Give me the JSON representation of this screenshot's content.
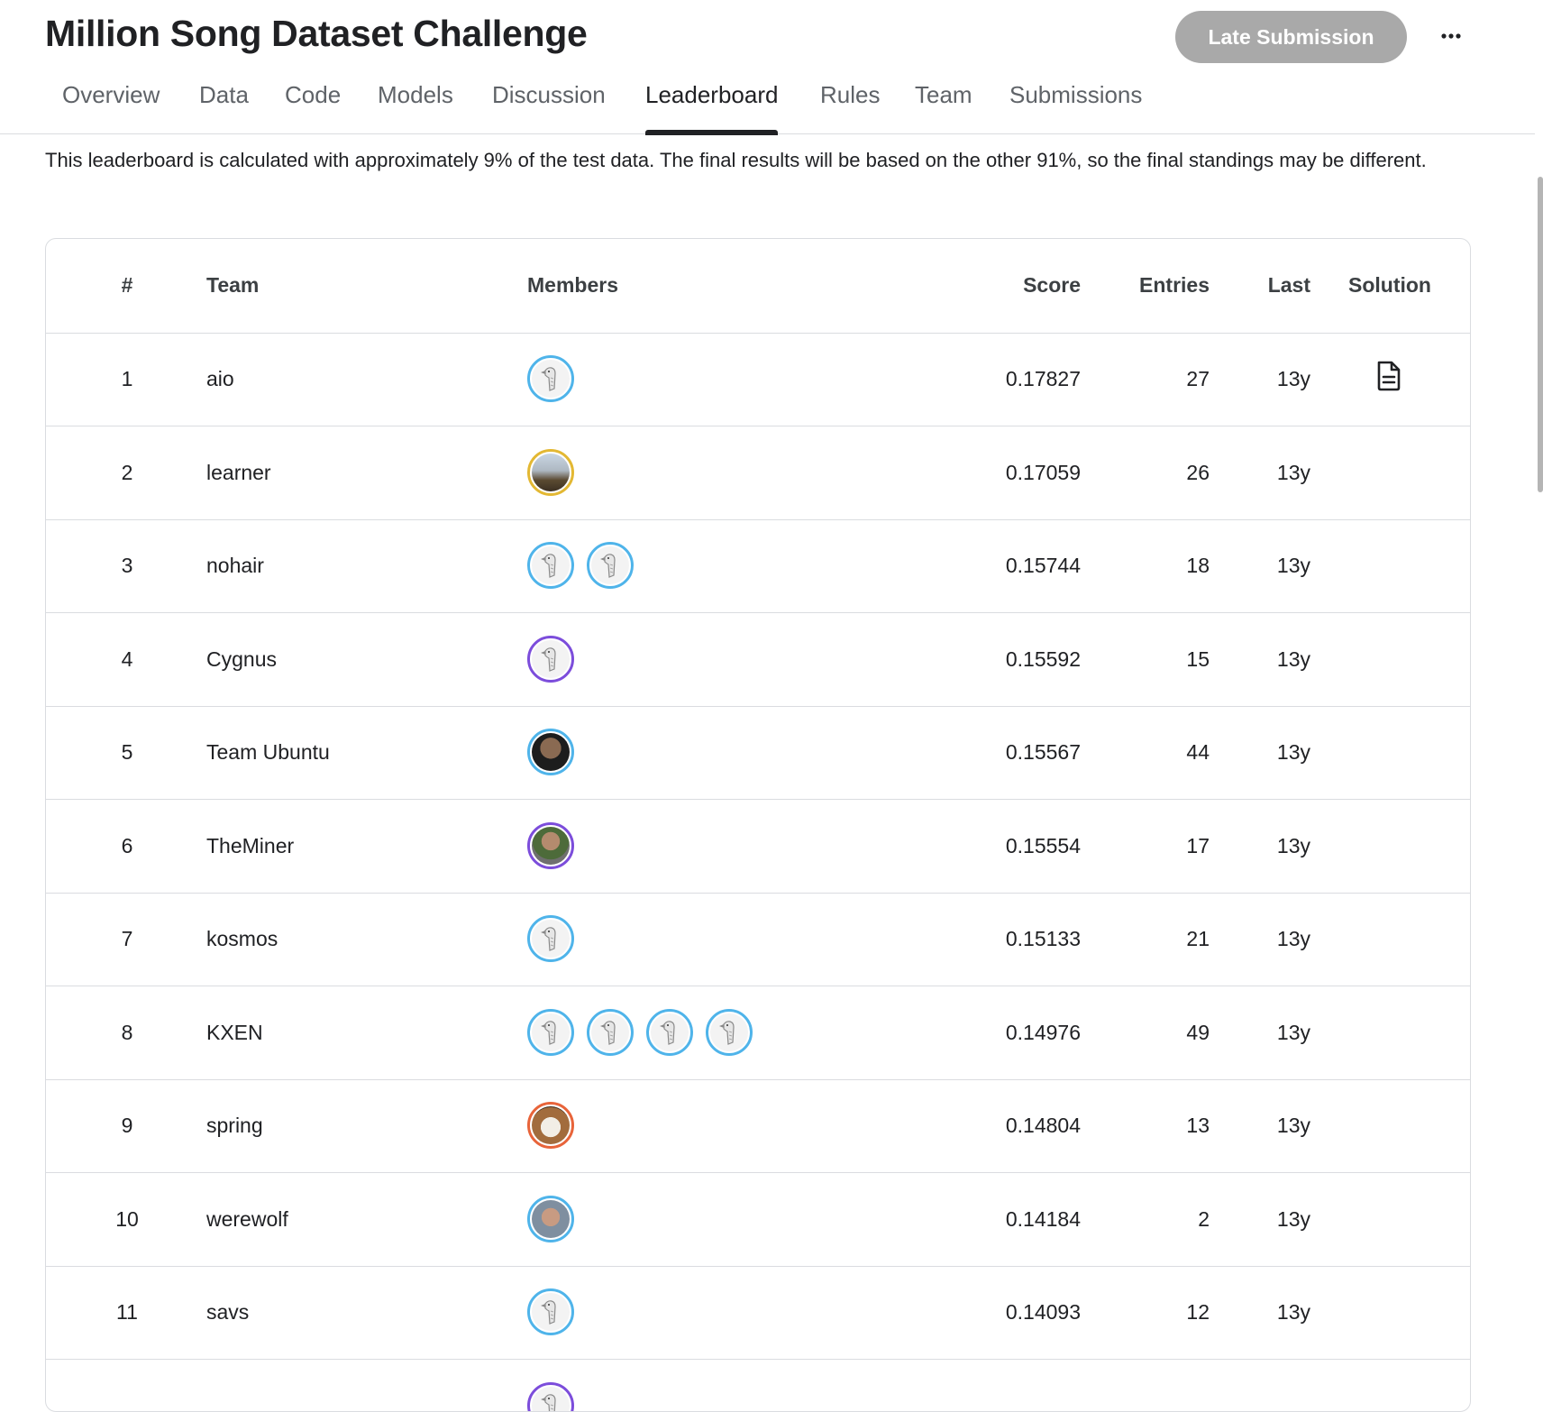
{
  "page": {
    "title": "Million Song Dataset Challenge",
    "late_submission_label": "Late Submission",
    "more_icon": "more-horizontal-icon"
  },
  "tabs": [
    {
      "label": "Overview",
      "active": false
    },
    {
      "label": "Data",
      "active": false
    },
    {
      "label": "Code",
      "active": false
    },
    {
      "label": "Models",
      "active": false
    },
    {
      "label": "Discussion",
      "active": false
    },
    {
      "label": "Leaderboard",
      "active": true
    },
    {
      "label": "Rules",
      "active": false
    },
    {
      "label": "Team",
      "active": false
    },
    {
      "label": "Submissions",
      "active": false
    }
  ],
  "notice": "This leaderboard is calculated with approximately 9% of the test data. The final results will be based on the other 91%, so the final standings may be different.",
  "table": {
    "columns": {
      "rank": "#",
      "team": "Team",
      "members": "Members",
      "score": "Score",
      "entries": "Entries",
      "last": "Last",
      "solution": "Solution"
    },
    "rows": [
      {
        "rank": "1",
        "team": "aio",
        "members": [
          "goose"
        ],
        "score": "0.17827",
        "entries": "27",
        "last": "13y",
        "solution": true
      },
      {
        "rank": "2",
        "team": "learner",
        "members": [
          "photo-landscape"
        ],
        "score": "0.17059",
        "entries": "26",
        "last": "13y",
        "solution": false
      },
      {
        "rank": "3",
        "team": "nohair",
        "members": [
          "goose",
          "goose"
        ],
        "score": "0.15744",
        "entries": "18",
        "last": "13y",
        "solution": false
      },
      {
        "rank": "4",
        "team": "Cygnus",
        "members": [
          "goose-purple"
        ],
        "score": "0.15592",
        "entries": "15",
        "last": "13y",
        "solution": false
      },
      {
        "rank": "5",
        "team": "Team Ubuntu",
        "members": [
          "photo-person-dark"
        ],
        "score": "0.15567",
        "entries": "44",
        "last": "13y",
        "solution": false
      },
      {
        "rank": "6",
        "team": "TheMiner",
        "members": [
          "photo-person-purple"
        ],
        "score": "0.15554",
        "entries": "17",
        "last": "13y",
        "solution": false
      },
      {
        "rank": "7",
        "team": "kosmos",
        "members": [
          "goose"
        ],
        "score": "0.15133",
        "entries": "21",
        "last": "13y",
        "solution": false
      },
      {
        "rank": "8",
        "team": "KXEN",
        "members": [
          "goose",
          "goose",
          "goose",
          "goose"
        ],
        "score": "0.14976",
        "entries": "49",
        "last": "13y",
        "solution": false
      },
      {
        "rank": "9",
        "team": "spring",
        "members": [
          "photo-cat"
        ],
        "score": "0.14804",
        "entries": "13",
        "last": "13y",
        "solution": false
      },
      {
        "rank": "10",
        "team": "werewolf",
        "members": [
          "photo-person-light"
        ],
        "score": "0.14184",
        "entries": "2",
        "last": "13y",
        "solution": false
      },
      {
        "rank": "11",
        "team": "savs",
        "members": [
          "goose"
        ],
        "score": "0.14093",
        "entries": "12",
        "last": "13y",
        "solution": false
      },
      {
        "rank": "",
        "team": "",
        "members": [
          "goose-purple"
        ],
        "score": "",
        "entries": "",
        "last": "",
        "solution": false
      }
    ]
  },
  "colors": {
    "ring_blue": "#4fb4ea",
    "ring_gold": "#e3b833",
    "ring_purple": "#7c4ddb",
    "ring_orange": "#e8643a",
    "late_button_bg": "#a9a9a9"
  }
}
